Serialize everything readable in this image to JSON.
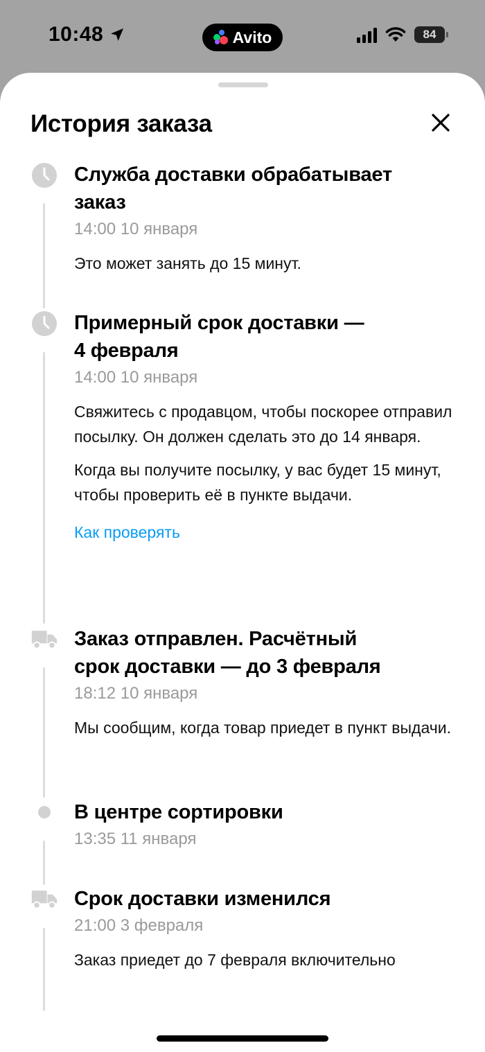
{
  "status_bar": {
    "time": "10:48",
    "app_pill": "Avito",
    "battery": "84"
  },
  "sheet": {
    "title": "История заказа"
  },
  "events": [
    {
      "icon": "clock-icon",
      "title_line1": "Служба доставки обрабатывает",
      "title_line2": "заказ",
      "time": "14:00 10 января",
      "text1": "Это может занять до 15 минут."
    },
    {
      "icon": "clock-icon",
      "title_line1": "Примерный срок доставки —",
      "title_line2": "4 февраля",
      "time": "14:00 10 января",
      "text1": "Свяжитесь с продавцом, чтобы поскорее отправил посылку. Он должен сделать это до 14 января.",
      "text2": "Когда вы получите посылку, у вас будет 15 минут, чтобы проверить её в пункте выдачи.",
      "link": "Как проверять"
    },
    {
      "icon": "truck-icon",
      "title_line1": "Заказ отправлен. Расчётный",
      "title_line2": "срок доставки — до 3 февраля",
      "time": "18:12 10 января",
      "text1": "Мы сообщим, когда товар приедет в пункт выдачи."
    },
    {
      "icon": "dot-icon",
      "title_line1": "В центре сортировки",
      "time": "13:35 11 января"
    },
    {
      "icon": "truck-icon",
      "title_line1": "Срок доставки изменился",
      "time": "21:00 3 февраля",
      "text1": "Заказ приедет до 7 февраля включительно"
    }
  ]
}
